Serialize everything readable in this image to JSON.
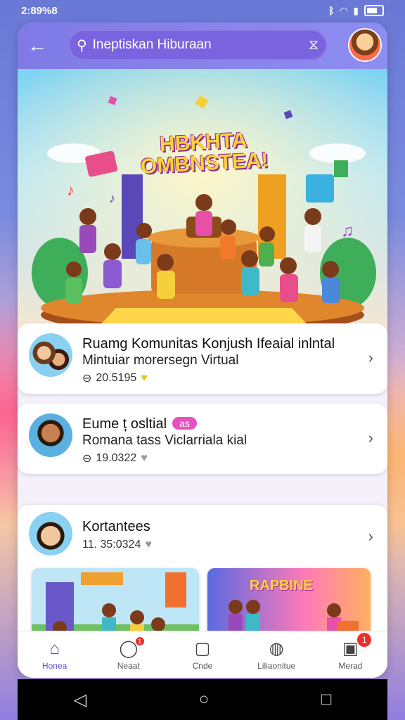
{
  "status_bar": {
    "time": "2:89%8"
  },
  "search": {
    "query": "Ineptiskan Hiburaan"
  },
  "hero": {
    "title_line1": "HBKHTA",
    "title_line2": "OMBNSTEA!"
  },
  "cards": [
    {
      "title": "Ruamg Komunitas Konjush Ifeaial inlntal",
      "subtitle": "Mintuiar morersegn Virtual",
      "meta": "20.5195"
    },
    {
      "title": "Eume t̟ osltial",
      "badge": "as",
      "subtitle": "Romana tass Viclarriala kial",
      "meta": "19.0322"
    },
    {
      "title": "Kortantees",
      "meta": "11. 35:0324"
    }
  ],
  "thumb2_label": "RAPBINE",
  "bottom_nav": [
    {
      "label": "Honea",
      "icon": "home-icon",
      "active": true
    },
    {
      "label": "Neaat",
      "icon": "chat-icon",
      "badge": "1"
    },
    {
      "label": "Cnde",
      "icon": "square-icon"
    },
    {
      "label": "Liliaonitue",
      "icon": "message-icon"
    },
    {
      "label": "Merad",
      "icon": "profile-icon",
      "badge": "1"
    }
  ],
  "colors": {
    "accent": "#5a4bd6",
    "topbar": "#8a86ee",
    "search_bg": "#7a63df",
    "badge": "#e84fc0"
  }
}
